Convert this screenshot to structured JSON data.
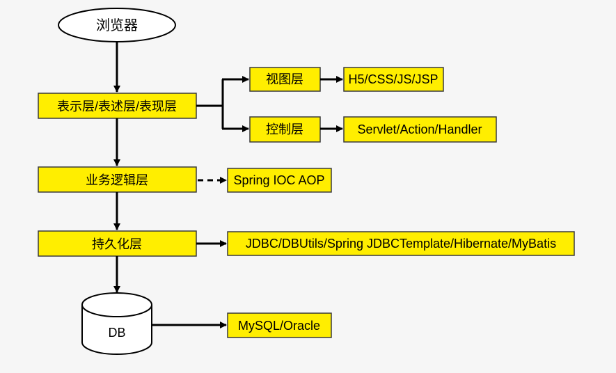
{
  "nodes": {
    "browser": "浏览器",
    "presentation_layer": "表示层/表述层/表现层",
    "view_layer": "视图层",
    "view_tech": "H5/CSS/JS/JSP",
    "control_layer": "控制层",
    "control_tech": "Servlet/Action/Handler",
    "business_layer": "业务逻辑层",
    "business_tech": "Spring IOC AOP",
    "persistence_layer": "持久化层",
    "persistence_tech": "JDBC/DBUtils/Spring JDBCTemplate/Hibernate/MyBatis",
    "db": "DB",
    "db_tech": "MySQL/Oracle"
  },
  "colors": {
    "box_fill": "#ffee00",
    "box_stroke": "#3a3a3a",
    "arrow": "#000000",
    "background": "#f6f6f6"
  }
}
